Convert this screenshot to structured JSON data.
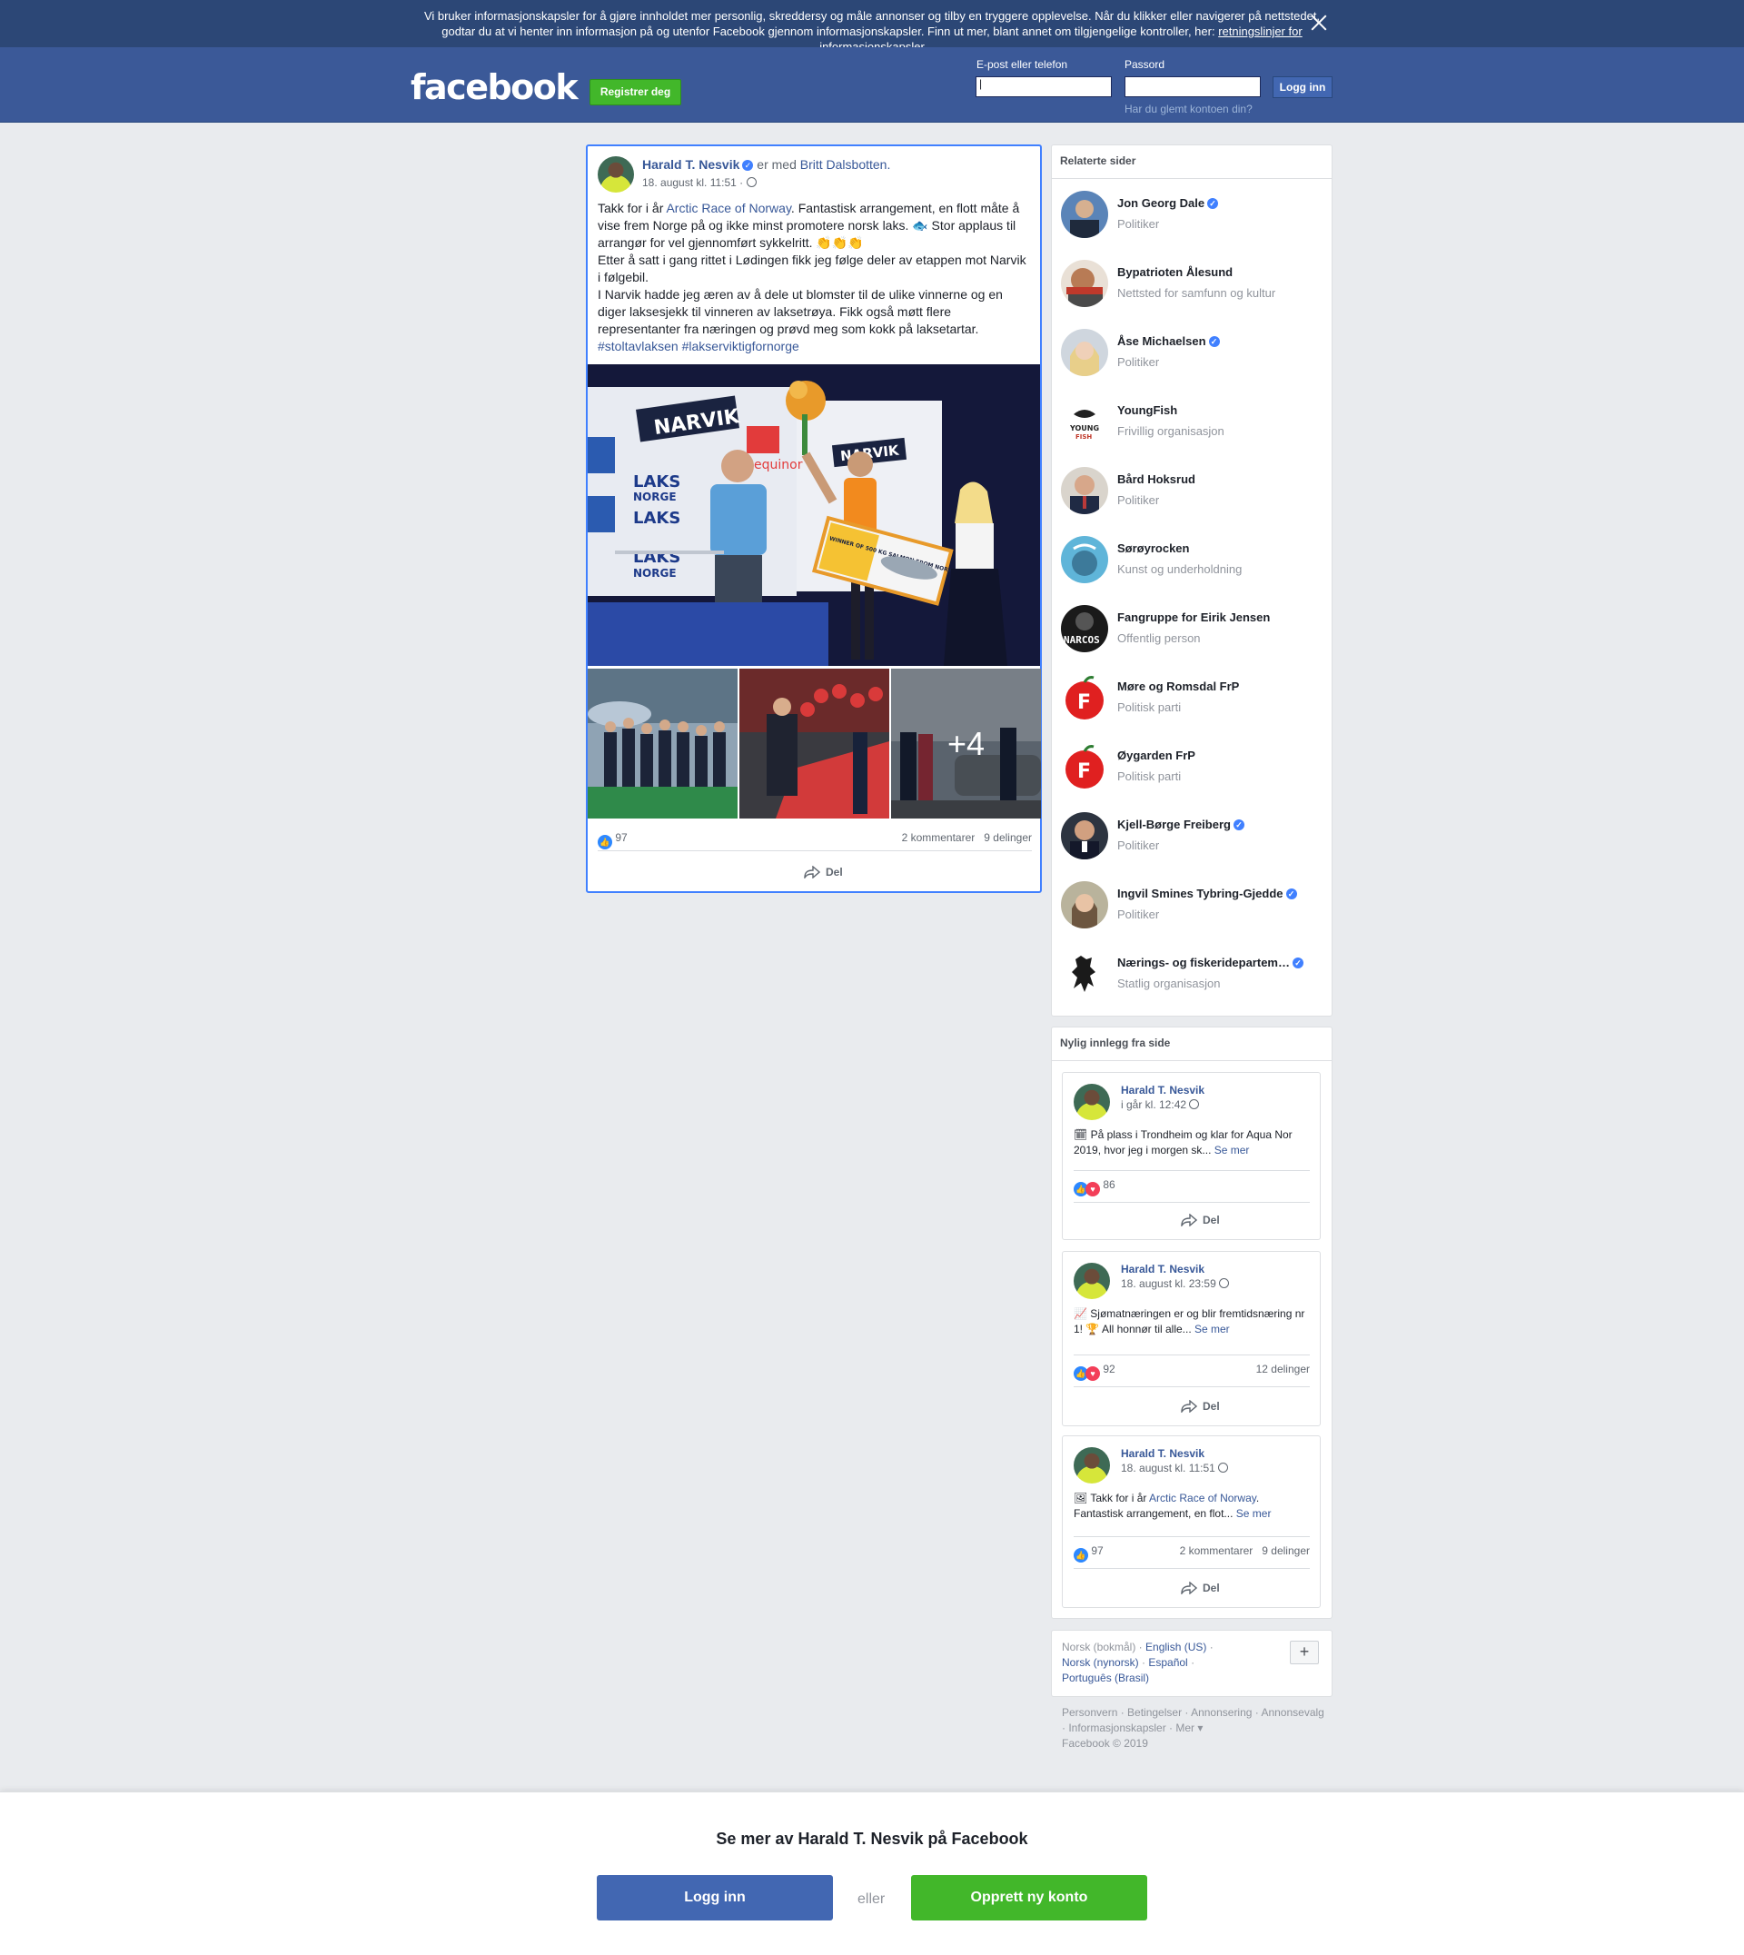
{
  "cookie": {
    "text": "Vi bruker informasjonskapsler for å gjøre innholdet mer personlig, skreddersy og måle annonser og tilby en tryggere opplevelse. Når du klikker eller navigerer på nettstedet, godtar du at vi henter inn informasjon på og utenfor Facebook gjennom informasjonskapsler. Finn ut mer, blant annet om tilgjengelige kontroller, her: ",
    "link": "retningslinjer for informasjonskapsler"
  },
  "header": {
    "logo": "facebook",
    "register": "Registrer deg",
    "email_label": "E-post eller telefon",
    "password_label": "Passord",
    "login": "Logg inn",
    "forgot": "Har du glemt kontoen din?"
  },
  "post": {
    "author": "Harald T. Nesvik",
    "with_text": " er med ",
    "tagged": "Britt Dalsbotten.",
    "date": "18. august kl. 11:51 · ",
    "body_pre": "Takk for i år ",
    "body_link": "Arctic Race of Norway",
    "body_1": ". Fantastisk arrangement, en flott måte å vise frem Norge på og ikke minst promotere norsk laks. 🐟 Stor applaus til arrangør for vel gjennomført sykkelritt. 👏👏👏",
    "body_2": "Etter å satt i gang rittet i Lødingen fikk jeg følge deler av etappen mot Narvik i følgebil.",
    "body_3": "I Narvik hadde jeg æren av å dele ut blomster til de ulike vinnerne og en diger laksesjekk til vinneren av laksetrøya. Fikk også møtt flere representanter fra næringen og prøvd meg som kokk på laksetartar.",
    "hashtags": "#stoltavlaksen #lakserviktigfornorge",
    "photo_signs": [
      "NARVIK",
      "NARVIK",
      "LAKS",
      "NORGE",
      "equinor",
      "WINNER OF 500 KG SALMON FROM NORWAY"
    ],
    "more_photos": "+4",
    "likes": "97",
    "comments": "2 kommentarer",
    "shares": "9 delinger",
    "share": "Del"
  },
  "related": {
    "title": "Relaterte sider",
    "items": [
      {
        "name": "Jon Georg Dale",
        "category": "Politiker",
        "verified": true
      },
      {
        "name": "Bypatrioten Ålesund",
        "category": "Nettsted for samfunn og kultur",
        "verified": false
      },
      {
        "name": "Åse Michaelsen",
        "category": "Politiker",
        "verified": true
      },
      {
        "name": "YoungFish",
        "category": "Frivillig organisasjon",
        "verified": false
      },
      {
        "name": "Bård Hoksrud",
        "category": "Politiker",
        "verified": false
      },
      {
        "name": "Sørøyrocken",
        "category": "Kunst og underholdning",
        "verified": false
      },
      {
        "name": "Fangruppe for Eirik Jensen",
        "category": "Offentlig person",
        "verified": false
      },
      {
        "name": "Møre og Romsdal FrP",
        "category": "Politisk parti",
        "verified": false
      },
      {
        "name": "Øygarden FrP",
        "category": "Politisk parti",
        "verified": false
      },
      {
        "name": "Kjell-Børge Freiberg",
        "category": "Politiker",
        "verified": true
      },
      {
        "name": "Ingvil Smines Tybring-Gjedde",
        "category": "Politiker",
        "verified": true
      },
      {
        "name": "Nærings- og fiskeridepartem…",
        "category": "Statlig organisasjon",
        "verified": true
      }
    ],
    "logo_texts": {
      "youngfish_1": "YOUNG",
      "youngfish_2": "FISH",
      "narcos": "NARCOS",
      "frp": "F"
    }
  },
  "recent": {
    "title": "Nylig innlegg fra side",
    "see_more": "Se mer",
    "share": "Del",
    "posts": [
      {
        "author": "Harald T. Nesvik",
        "date": "i går kl. 12:42 ",
        "icon": "🗓",
        "text": " På plass i Trondheim og klar for Aqua Nor 2019, hvor jeg i morgen sk... ",
        "link": "",
        "text2": "",
        "reactions": "86",
        "shares": ""
      },
      {
        "author": "Harald T. Nesvik",
        "date": "18. august kl. 23:59 ",
        "icon": "📈",
        "text": " Sjømatnæringen er og blir fremtidsnæring nr 1! 🏆 All honnør til alle... ",
        "link": "",
        "text2": "",
        "reactions": "92",
        "shares": "12 delinger"
      },
      {
        "author": "Harald T. Nesvik",
        "date": "18. august kl. 11:51 ",
        "icon": "🖼",
        "text": " Takk for i år ",
        "link": "Arctic Race of Norway",
        "text2": ". Fantastisk arrangement, en flot... ",
        "reactions": "97",
        "comments": "2 kommentarer",
        "shares": "9 delinger"
      }
    ]
  },
  "languages": {
    "current": "Norsk (bokmål) · ",
    "l1": "English (US)",
    "sep1": " · ",
    "l2": "Norsk (nynorsk)",
    "sep2": " · ",
    "l3": "Español",
    "sep3": " · ",
    "l4": "Português (Brasil)",
    "plus": "+"
  },
  "footer": {
    "links": "Personvern · Betingelser · Annonsering · Annonsevalg",
    "links2": " · Informasjonskapsler · Mer ▾",
    "copyright": "Facebook © 2019"
  },
  "bottom_bar": {
    "title": "Se mer av Harald T. Nesvik på Facebook",
    "login": "Logg inn",
    "or": "eller",
    "create": "Opprett ny konto"
  },
  "colors": {
    "brand": "#3b5998",
    "cookie_bg": "#2c4776",
    "green": "#42b72a",
    "login_blue": "#4267b2",
    "link": "#385898"
  }
}
